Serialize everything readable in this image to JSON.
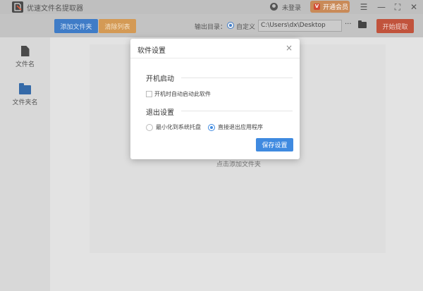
{
  "titlebar": {
    "app_title": "优速文件名提取器",
    "login_text": "未登录",
    "vip_label": "开通会员",
    "vip_icon_text": "V",
    "menu_icon": "☰",
    "minimize_icon": "—",
    "maximize_icon": "⛶",
    "close_icon": "✕"
  },
  "toolbar": {
    "add_folder_label": "添加文件夹",
    "clear_list_label": "清除列表",
    "output_dir_label": "输出目录：",
    "custom_radio_label": "自定义",
    "output_path": "C:\\Users\\dx\\Desktop",
    "more_label": "···",
    "start_label": "开始提取"
  },
  "sidebar": {
    "items": [
      {
        "label": "文件名",
        "icon": "file-icon"
      },
      {
        "label": "文件夹名",
        "icon": "folder-icon"
      }
    ]
  },
  "content": {
    "drop_hint": "点击添加文件夹"
  },
  "modal": {
    "title": "软件设置",
    "close_icon": "×",
    "startup_section": "开机启动",
    "startup_checkbox_label": "开机时自动启动此软件",
    "startup_checked": false,
    "exit_section": "退出设置",
    "exit_options": [
      {
        "label": "最小化到系统托盘",
        "checked": false
      },
      {
        "label": "直接退出应用程序",
        "checked": true
      }
    ],
    "save_label": "保存设置"
  },
  "colors": {
    "primary_blue": "#3f8ae0",
    "add_button": "#3f7cc7",
    "clear_button": "#d49a55",
    "start_button": "#c1533c",
    "vip_button": "#c98a58"
  }
}
